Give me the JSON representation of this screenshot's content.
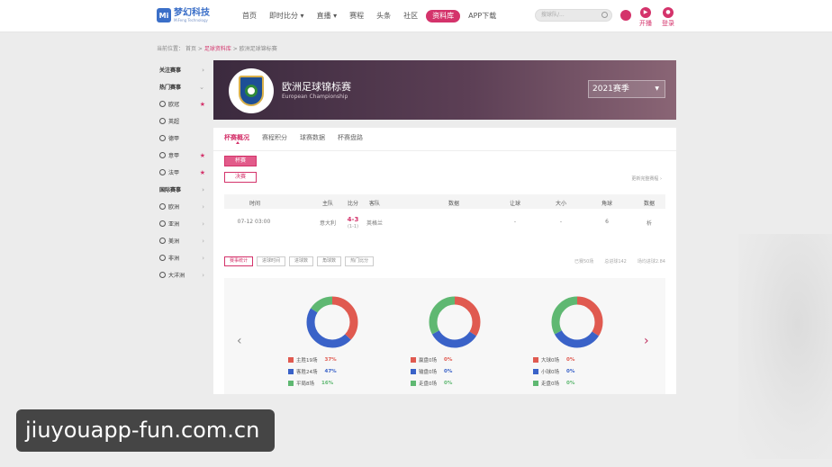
{
  "header": {
    "logo_mark": "Mi",
    "logo_text": "梦幻科技",
    "logo_sub": "MiFeng Technology",
    "nav": [
      "首页",
      "即时比分 ▾",
      "直播 ▾",
      "赛程",
      "头条",
      "社区",
      "资料库",
      "APP下载"
    ],
    "active_nav_index": 6,
    "search_placeholder": "搜球队/...",
    "icon_labels": [
      "开播",
      "登录"
    ]
  },
  "breadcrumb": {
    "prefix": "当前位置：",
    "home": "首页",
    "sep1": " > ",
    "db": "足球资料库",
    "sep2": " > ",
    "current": "欧洲足球锦标赛"
  },
  "sidebar": {
    "items": [
      {
        "label": "关注赛事",
        "type": "group",
        "mark": "›"
      },
      {
        "label": "热门赛事",
        "type": "group",
        "mark": "⌄"
      },
      {
        "label": "欧冠",
        "type": "item",
        "mark": "★"
      },
      {
        "label": "英超",
        "type": "item",
        "mark": ""
      },
      {
        "label": "德甲",
        "type": "item",
        "mark": ""
      },
      {
        "label": "意甲",
        "type": "item",
        "mark": "★"
      },
      {
        "label": "法甲",
        "type": "item",
        "mark": "★"
      },
      {
        "label": "国际赛事",
        "type": "group",
        "mark": "›"
      },
      {
        "label": "欧洲",
        "type": "item",
        "mark": "›"
      },
      {
        "label": "亚洲",
        "type": "item",
        "mark": "›"
      },
      {
        "label": "美洲",
        "type": "item",
        "mark": "›"
      },
      {
        "label": "非洲",
        "type": "item",
        "mark": "›"
      },
      {
        "label": "大洋洲",
        "type": "item",
        "mark": "›"
      }
    ]
  },
  "banner": {
    "title": "欧洲足球锦标赛",
    "subtitle": "European Championship",
    "badge_text": "ITALIA",
    "season": "2021赛季"
  },
  "tabs": [
    "杯赛概况",
    "赛程积分",
    "球赛数据",
    "杯赛盘路"
  ],
  "active_tab": 0,
  "sub_buttons": [
    "杯赛",
    "决赛"
  ],
  "more_link": "更新完整赛程 ›",
  "table": {
    "headers": [
      "时间",
      "主队",
      "比分",
      "客队",
      "数据",
      "让球",
      "大小",
      "角球",
      "数据"
    ],
    "rows": [
      {
        "time": "07-12 03:00",
        "home": "意大利",
        "score": "4-3",
        "ht": "(1-1)",
        "away": "英格兰",
        "data": "",
        "handicap": "-",
        "ou": "-",
        "corner": "6",
        "stat": "析"
      }
    ]
  },
  "filters": {
    "buttons": [
      "赛事统计",
      "进球时间",
      "进球数",
      "角球数",
      "热门比分"
    ],
    "active": 0,
    "right": [
      "已赛50场",
      "总进球142",
      "场均进球2.84"
    ]
  },
  "donuts": [
    {
      "segments": [
        {
          "label": "主胜19场",
          "pct": "37%",
          "color": "#e05a50",
          "value": 37
        },
        {
          "label": "客胜24场",
          "pct": "47%",
          "color": "#3a62c8",
          "value": 47
        },
        {
          "label": "平局8场",
          "pct": "16%",
          "color": "#5fb872",
          "value": 16
        }
      ]
    },
    {
      "segments": [
        {
          "label": "赢盘0场",
          "pct": "0%",
          "color": "#e05a50",
          "value": 34
        },
        {
          "label": "输盘0场",
          "pct": "0%",
          "color": "#3a62c8",
          "value": 33
        },
        {
          "label": "走盘0场",
          "pct": "0%",
          "color": "#5fb872",
          "value": 33
        }
      ]
    },
    {
      "segments": [
        {
          "label": "大球0场",
          "pct": "0%",
          "color": "#e05a50",
          "value": 34
        },
        {
          "label": "小球0场",
          "pct": "0%",
          "color": "#3a62c8",
          "value": 33
        },
        {
          "label": "走盘0场",
          "pct": "0%",
          "color": "#5fb872",
          "value": 33
        }
      ]
    }
  ],
  "arrows": {
    "left": "‹",
    "right": "›"
  },
  "watermark": "jiuyouapp-fun.com.cn"
}
